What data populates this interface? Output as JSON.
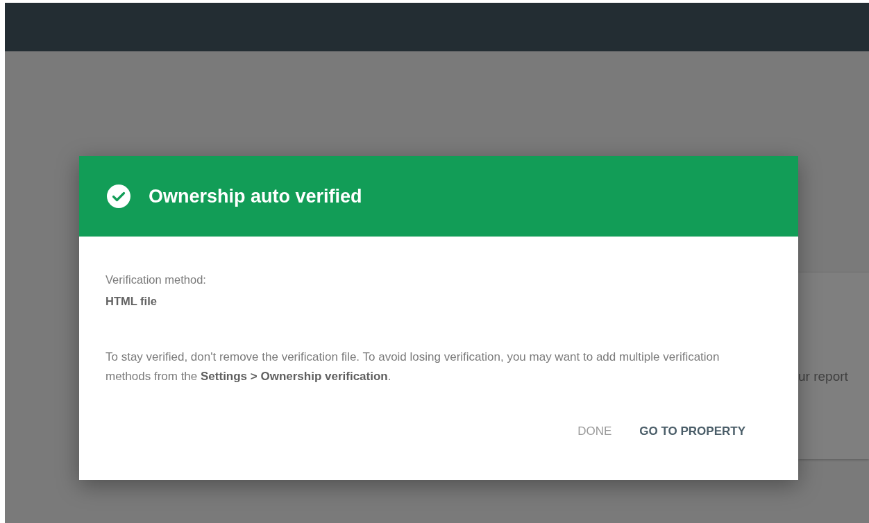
{
  "background_card": {
    "text": "ur report"
  },
  "dialog": {
    "title": "Ownership auto verified",
    "verified": true,
    "method_label": "Verification method:",
    "method_value": "HTML file",
    "message": "To stay verified, don't remove the verification file. To avoid losing verification, you may want to add multiple verification methods from the **Settings > Ownership verification**.",
    "buttons": [
      {
        "label": "DONE",
        "kind": "secondary"
      },
      {
        "label": "GO TO PROPERTY",
        "kind": "primary"
      }
    ]
  }
}
